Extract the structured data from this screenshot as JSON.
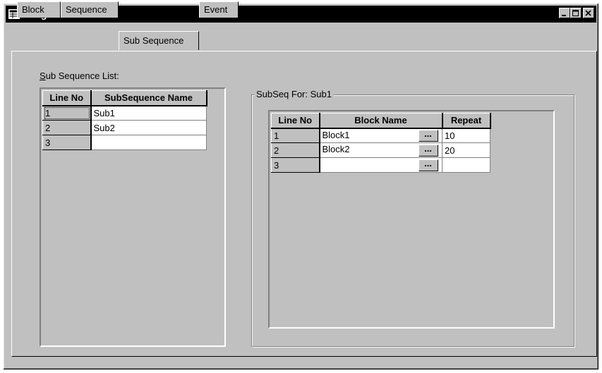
{
  "window": {
    "title": "Program : PG 1"
  },
  "tabs": [
    {
      "label": "Block"
    },
    {
      "label": "Sequence"
    },
    {
      "label": "Sub Sequence"
    },
    {
      "label": "Event"
    }
  ],
  "active_tab": "Sub Sequence",
  "subsequence_list": {
    "label_prefix": "S",
    "label_rest": "ub Sequence List:",
    "columns": [
      "Line No",
      "SubSequence Name"
    ],
    "rows": [
      {
        "line": "1",
        "name": "Sub1"
      },
      {
        "line": "2",
        "name": "Sub2"
      },
      {
        "line": "3",
        "name": ""
      }
    ]
  },
  "subseq_group": {
    "legend": "SubSeq For: Sub1",
    "columns": [
      "Line No",
      "Block Name",
      "Repeat"
    ],
    "button_label": "...",
    "rows": [
      {
        "line": "1",
        "block": "Block1",
        "repeat": "10"
      },
      {
        "line": "2",
        "block": "Block2",
        "repeat": "20"
      },
      {
        "line": "3",
        "block": "",
        "repeat": ""
      }
    ]
  },
  "colors": {
    "face": "#c0c0c0",
    "titlebar": "#000000"
  }
}
